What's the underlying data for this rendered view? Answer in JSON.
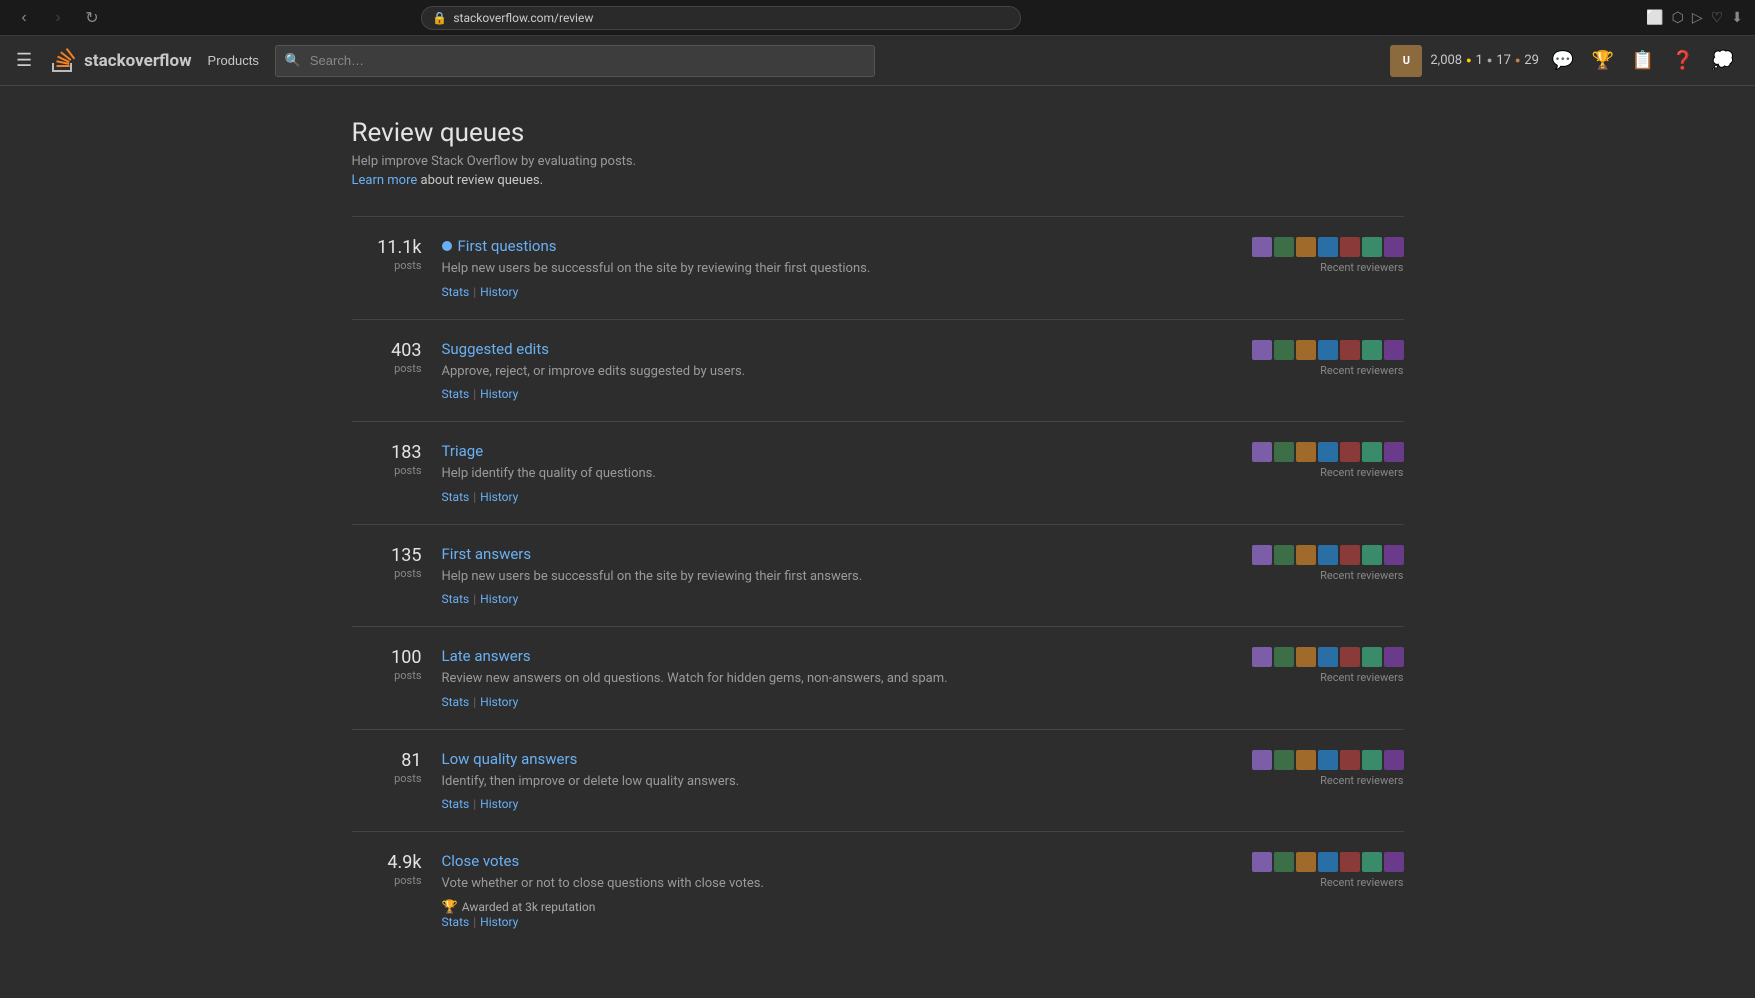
{
  "browser": {
    "url": "stackoverflow.com/review",
    "lock_icon": "🔒"
  },
  "navbar": {
    "hamburger_label": "☰",
    "logo_text_plain": "stack",
    "logo_text_bold": "overflow",
    "products_label": "Products",
    "search_placeholder": "Search…",
    "reputation": "2,008",
    "badge_gold_count": "1",
    "badge_silver_count": "17",
    "badge_bronze_count": "29"
  },
  "page": {
    "title": "Review queues",
    "subtitle": "Help improve Stack Overflow by evaluating posts.",
    "learn_more_text": "Learn more",
    "learn_more_suffix": " about review queues."
  },
  "queues": [
    {
      "id": "first-questions",
      "count": "11.1k",
      "count_label": "posts",
      "name": "First questions",
      "has_active_dot": true,
      "description": "Help new users be successful on the site by reviewing their first questions.",
      "stats_label": "Stats",
      "history_label": "History"
    },
    {
      "id": "suggested-edits",
      "count": "403",
      "count_label": "posts",
      "name": "Suggested edits",
      "has_active_dot": false,
      "description": "Approve, reject, or improve edits suggested by users.",
      "stats_label": "Stats",
      "history_label": "History"
    },
    {
      "id": "triage",
      "count": "183",
      "count_label": "posts",
      "name": "Triage",
      "has_active_dot": false,
      "description": "Help identify the quality of questions.",
      "stats_label": "Stats",
      "history_label": "History"
    },
    {
      "id": "first-answers",
      "count": "135",
      "count_label": "posts",
      "name": "First answers",
      "has_active_dot": false,
      "description": "Help new users be successful on the site by reviewing their first answers.",
      "stats_label": "Stats",
      "history_label": "History"
    },
    {
      "id": "late-answers",
      "count": "100",
      "count_label": "posts",
      "name": "Late answers",
      "has_active_dot": false,
      "description": "Review new answers on old questions. Watch for hidden gems, non-answers, and spam.",
      "stats_label": "Stats",
      "history_label": "History"
    },
    {
      "id": "low-quality-answers",
      "count": "81",
      "count_label": "posts",
      "name": "Low quality answers",
      "has_active_dot": false,
      "description": "Identify, then improve or delete low quality answers.",
      "stats_label": "Stats",
      "history_label": "History"
    },
    {
      "id": "close-votes",
      "count": "4.9k",
      "count_label": "posts",
      "name": "Close votes",
      "has_active_dot": false,
      "description": "Vote whether or not to close questions with close votes.",
      "stats_label": "Stats",
      "history_label": "History",
      "award": "Awarded at 3k reputation"
    }
  ],
  "recent_reviewers_label": "Recent reviewers"
}
